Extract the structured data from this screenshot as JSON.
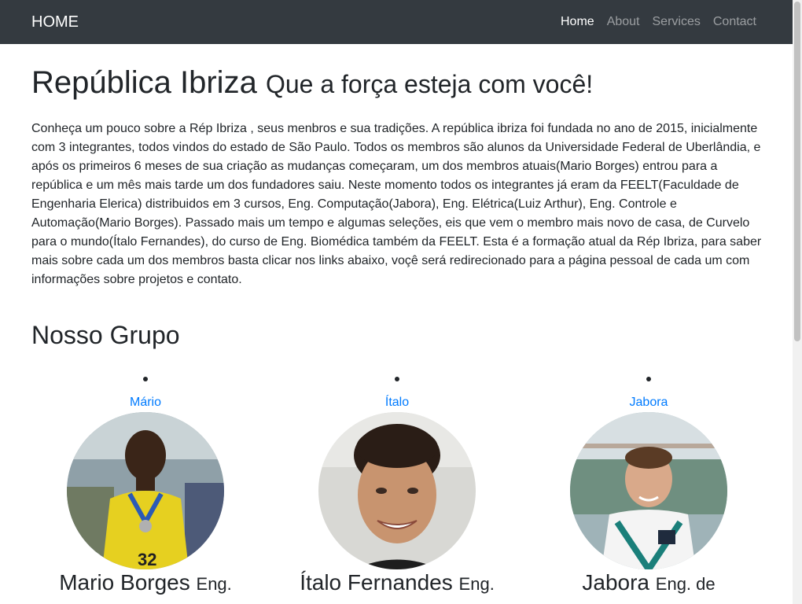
{
  "navbar": {
    "brand": "HOME",
    "links": [
      "Home",
      "About",
      "Services",
      "Contact"
    ],
    "active": "Home"
  },
  "header": {
    "title": "República Ibriza",
    "subtitle": "Que a força esteja com você!"
  },
  "intro": "Conheça um pouco sobre a Rép Ibriza , seus menbros e sua tradições. A república ibriza foi fundada no ano de 2015, inicialmente com 3 integrantes, todos vindos do estado de São Paulo. Todos os membros são alunos da Universidade Federal de Uberlândia, e após os primeiros 6 meses de sua criação as mudanças começaram, um dos membros atuais(Mario Borges) entrou para a república e um mês mais tarde um dos fundadores saiu. Neste momento todos os integrantes já eram da FEELT(Faculdade de Engenharia Elerica) distribuidos em 3 cursos, Eng. Computação(Jabora), Eng. Elétrica(Luiz Arthur), Eng. Controle e Automação(Mario Borges). Passado mais um tempo e algumas seleções, eis que vem o membro mais novo de casa, de Curvelo para o mundo(Ítalo Fernandes), do curso de Eng. Biomédica também da FEELT. Esta é a formação atual da Rép Ibriza, para saber mais sobre cada um dos membros basta clicar nos links abaixo, voçê será redirecionado para a página pessoal de cada um com informações sobre projetos e contato.",
  "group": {
    "heading": "Nosso Grupo",
    "members": [
      {
        "link": "Mário",
        "name": "Mario Borges",
        "course": "Eng."
      },
      {
        "link": "Ítalo",
        "name": "Ítalo Fernandes",
        "course": "Eng."
      },
      {
        "link": "Jabora",
        "name": "Jabora",
        "course": "Eng. de"
      }
    ]
  },
  "colors": {
    "navbar_bg": "#343a40",
    "link": "#007bff",
    "text": "#212529"
  }
}
